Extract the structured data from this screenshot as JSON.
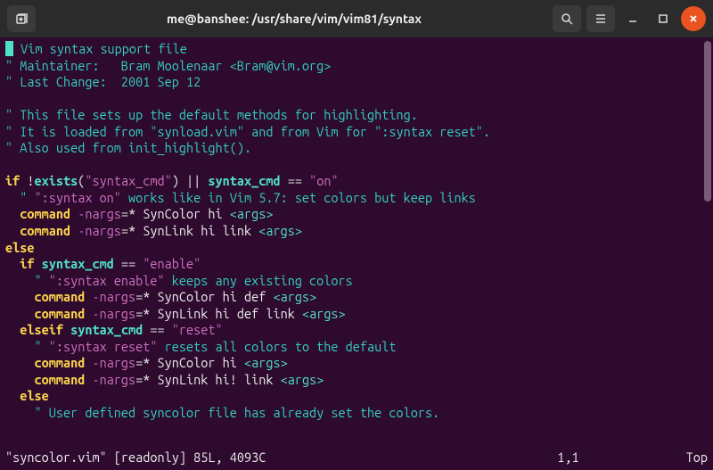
{
  "titlebar": {
    "title": "me@banshee: /usr/share/vim/vim81/syntax"
  },
  "header_comments": [
    " Vim syntax support file",
    " Maintainer:   Bram Moolenaar <Bram@vim.org>",
    " Last Change:  2001 Sep 12"
  ],
  "desc_comments": [
    " This file sets up the default methods for highlighting.",
    " It is loaded from \"synload.vim\" and from Vim for \":syntax reset\".",
    " Also used from init_highlight()."
  ],
  "if1": {
    "kw_if": "if",
    "bang": "!",
    "fn": "exists",
    "paren_open": "(",
    "arg": "\"syntax_cmd\"",
    "paren_close": ")",
    "op_or": " || ",
    "ident": "syntax_cmd",
    "op_eq": " == ",
    "val": "\"on\""
  },
  "comment_on": {
    "pre": "  \" ",
    "q": "\":syntax on\"",
    "post": " works like in Vim 5.7: set colors but keep links"
  },
  "cmd_on_1": {
    "kw": "command",
    "flag": "-nargs",
    "rest": "=* SynColor hi ",
    "arg": "<args>"
  },
  "cmd_on_2": {
    "kw": "command",
    "flag": "-nargs",
    "rest": "=* SynLink hi link ",
    "arg": "<args>"
  },
  "kw_else_main": "else",
  "if2": {
    "kw_if": "if",
    "ident": "syntax_cmd",
    "op_eq": " == ",
    "val": "\"enable\""
  },
  "comment_enable": {
    "pre": "    \" ",
    "q": "\":syntax enable\"",
    "post": " keeps any existing colors"
  },
  "cmd_en_1": {
    "kw": "command",
    "flag": "-nargs",
    "rest": "=* SynColor hi def ",
    "arg": "<args>"
  },
  "cmd_en_2": {
    "kw": "command",
    "flag": "-nargs",
    "rest": "=* SynLink hi def link ",
    "arg": "<args>"
  },
  "elseif_reset": {
    "kw": "elseif",
    "ident": "syntax_cmd",
    "op_eq": " == ",
    "val": "\"reset\""
  },
  "comment_reset": {
    "pre": "    \" ",
    "q": "\":syntax reset\"",
    "post": " resets all colors to the default"
  },
  "cmd_re_1": {
    "kw": "command",
    "flag": "-nargs",
    "rest": "=* SynColor hi ",
    "arg": "<args>"
  },
  "cmd_re_2": {
    "kw": "command",
    "flag": "-nargs",
    "rest": "=* SynLink hi! link ",
    "arg": "<args>"
  },
  "kw_else_inner": "else",
  "comment_user": "    \" User defined syncolor file has already set the colors.",
  "status": {
    "left": "\"syncolor.vim\" [readonly] 85L, 4093C",
    "pos": "1,1",
    "pct": "Top"
  }
}
